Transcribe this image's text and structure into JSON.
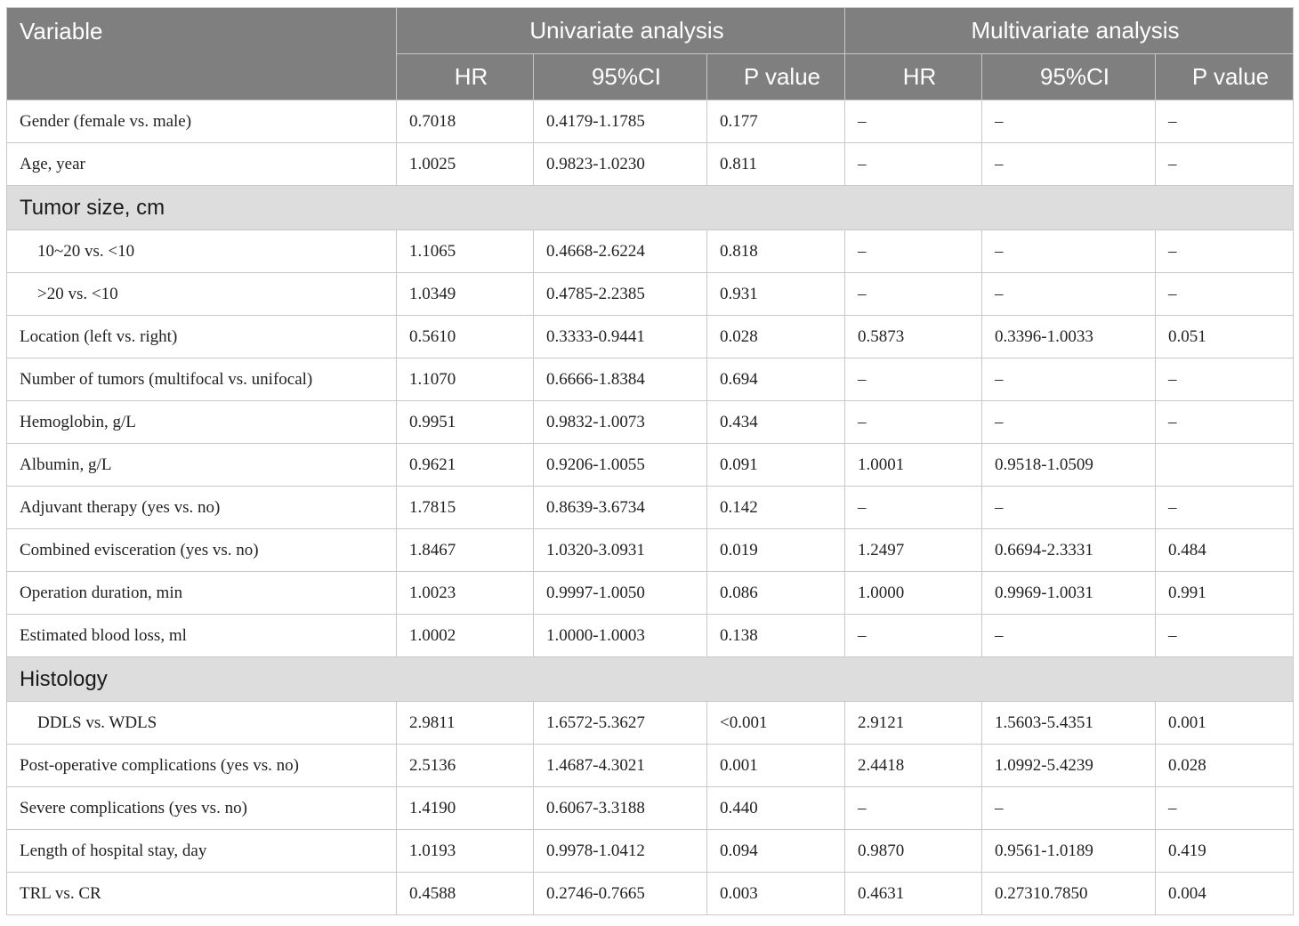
{
  "header": {
    "variable": "Variable",
    "univariate": "Univariate analysis",
    "multivariate": "Multivariate analysis",
    "subcols": [
      "HR",
      "95%CI",
      "P value",
      "HR",
      "95%CI",
      "P value"
    ]
  },
  "rows": [
    {
      "type": "data",
      "label": "Gender (female vs. male)",
      "cells": [
        "0.7018",
        "0.4179-1.1785",
        "0.177",
        "–",
        "–",
        "–"
      ]
    },
    {
      "type": "data",
      "label": "Age, year",
      "cells": [
        "1.0025",
        "0.9823-1.0230",
        "0.811",
        "–",
        "–",
        "–"
      ]
    },
    {
      "type": "section",
      "label": "Tumor size, cm"
    },
    {
      "type": "data",
      "indent": true,
      "label": "10~20 vs. <10",
      "cells": [
        "1.1065",
        "0.4668-2.6224",
        "0.818",
        "–",
        "–",
        "–"
      ]
    },
    {
      "type": "data",
      "indent": true,
      "label": ">20 vs. <10",
      "cells": [
        "1.0349",
        "0.4785-2.2385",
        "0.931",
        "–",
        "–",
        "–"
      ]
    },
    {
      "type": "data",
      "label": "Location (left vs. right)",
      "cells": [
        "0.5610",
        "0.3333-0.9441",
        "0.028",
        "0.5873",
        "0.3396-1.0033",
        "0.051"
      ]
    },
    {
      "type": "data",
      "label": "Number of tumors (multifocal vs. unifocal)",
      "cells": [
        "1.1070",
        "0.6666-1.8384",
        "0.694",
        "–",
        "–",
        "–"
      ]
    },
    {
      "type": "data",
      "label": "Hemoglobin, g/L",
      "cells": [
        "0.9951",
        "0.9832-1.0073",
        "0.434",
        "–",
        "–",
        "–"
      ]
    },
    {
      "type": "data",
      "label": "Albumin, g/L",
      "cells": [
        "0.9621",
        "0.9206-1.0055",
        "0.091",
        "1.0001",
        "0.9518-1.0509",
        ""
      ]
    },
    {
      "type": "data",
      "label": "Adjuvant therapy (yes vs. no)",
      "cells": [
        "1.7815",
        "0.8639-3.6734",
        "0.142",
        "–",
        "–",
        "–"
      ]
    },
    {
      "type": "data",
      "label": "Combined evisceration (yes vs. no)",
      "cells": [
        "1.8467",
        "1.0320-3.0931",
        "0.019",
        "1.2497",
        "0.6694-2.3331",
        "0.484"
      ]
    },
    {
      "type": "data",
      "label": "Operation duration, min",
      "cells": [
        "1.0023",
        "0.9997-1.0050",
        "0.086",
        "1.0000",
        "0.9969-1.0031",
        "0.991"
      ]
    },
    {
      "type": "data",
      "label": "Estimated blood loss, ml",
      "cells": [
        "1.0002",
        "1.0000-1.0003",
        "0.138",
        "–",
        "–",
        "–"
      ]
    },
    {
      "type": "section",
      "label": "Histology"
    },
    {
      "type": "data",
      "indent": true,
      "label": "DDLS vs. WDLS",
      "cells": [
        "2.9811",
        "1.6572-5.3627",
        "<0.001",
        "2.9121",
        "1.5603-5.4351",
        "0.001"
      ]
    },
    {
      "type": "data",
      "label": "Post-operative complications (yes vs. no)",
      "cells": [
        "2.5136",
        "1.4687-4.3021",
        "0.001",
        "2.4418",
        "1.0992-5.4239",
        "0.028"
      ]
    },
    {
      "type": "data",
      "label": "Severe complications (yes vs. no)",
      "cells": [
        "1.4190",
        "0.6067-3.3188",
        "0.440",
        "–",
        "–",
        "–"
      ]
    },
    {
      "type": "data",
      "label": "Length of hospital stay, day",
      "cells": [
        "1.0193",
        "0.9978-1.0412",
        "0.094",
        "0.9870",
        "0.9561-1.0189",
        "0.419"
      ]
    },
    {
      "type": "data",
      "label": "TRL vs. CR",
      "cells": [
        "0.4588",
        "0.2746-0.7665",
        "0.003",
        "0.4631",
        "0.27310.7850",
        "0.004"
      ]
    }
  ]
}
